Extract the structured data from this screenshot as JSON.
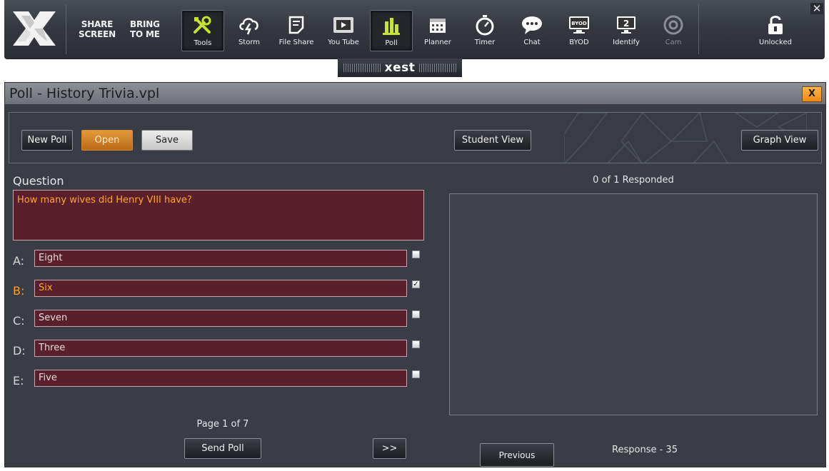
{
  "toolbar": {
    "share_screen": [
      "SHARE",
      "SCREEN"
    ],
    "bring_to_me": [
      "BRING",
      "TO ME"
    ],
    "tools": [
      {
        "label": "Tools",
        "icon": "tools-icon",
        "selected": true
      },
      {
        "label": "Storm",
        "icon": "storm-icon"
      },
      {
        "label": "File Share",
        "icon": "file-share-icon"
      },
      {
        "label": "You Tube",
        "icon": "youtube-icon"
      },
      {
        "label": "Poll",
        "icon": "poll-icon",
        "selected": true
      },
      {
        "label": "Planner",
        "icon": "planner-icon"
      },
      {
        "label": "Timer",
        "icon": "timer-icon"
      },
      {
        "label": "Chat",
        "icon": "chat-icon"
      },
      {
        "label": "BYOD",
        "icon": "byod-icon"
      },
      {
        "label": "Identify",
        "icon": "identify-icon"
      },
      {
        "label": "Cam",
        "icon": "cam-icon",
        "disabled": true
      }
    ],
    "lock": {
      "label": "Unlocked",
      "icon": "unlocked-icon"
    },
    "close": "✕",
    "brand": "xest",
    "byod_text": "BYOD",
    "identify_number": "2"
  },
  "window": {
    "title": "Poll - History Trivia.vpl",
    "close_label": "X"
  },
  "controls": {
    "new_poll": "New Poll",
    "open": "Open",
    "save": "Save",
    "student_view": "Student View",
    "graph_view": "Graph View"
  },
  "question": {
    "label": "Question",
    "text": "How many wives did Henry VIII have?"
  },
  "answers": [
    {
      "letter": "A:",
      "text": "Eight",
      "checked": false
    },
    {
      "letter": "B:",
      "text": "Six",
      "checked": true
    },
    {
      "letter": "C:",
      "text": "Seven",
      "checked": false
    },
    {
      "letter": "D:",
      "text": "Three",
      "checked": false
    },
    {
      "letter": "E:",
      "text": "Five",
      "checked": false
    }
  ],
  "results": {
    "responded": "0 of 1 Responded",
    "response": "Response - 35"
  },
  "paging": {
    "page": "Page 1 of 7",
    "send_poll": "Send Poll",
    "next": ">>",
    "previous": "Previous"
  },
  "colors": {
    "accent": "#ffa726",
    "answer_bg": "#5a1f2d",
    "panel_bg": "#3a3d46"
  }
}
